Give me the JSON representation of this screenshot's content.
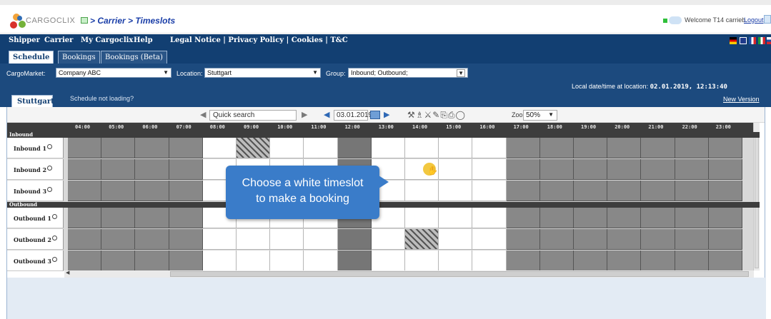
{
  "app": {
    "brand": "CARGOCLIX",
    "breadcrumb": "> Carrier > Timeslots",
    "welcome": "Welcome T14 carrieb.",
    "logout": "Logout"
  },
  "nav": {
    "items": [
      "Shipper",
      "Carrier",
      "My Cargoclix",
      "Help",
      "Legal Notice | Privacy Policy | Cookies | T&C"
    ]
  },
  "tabs": [
    "Schedule",
    "Bookings",
    "Bookings (Beta)"
  ],
  "filters": {
    "cargomarket_label": "CargoMarket:",
    "cargomarket_value": "Company ABC",
    "location_label": "Location:",
    "location_value": "Stuttgart",
    "group_label": "Group:",
    "group_value": "Inbound; Outbound;",
    "local_dt_label": "Local date/time at location:",
    "local_dt_value": "02.01.2019, 12:13:40",
    "new_version": "New Version"
  },
  "location_tab": "Stuttgart",
  "schedule_not_loading": "Schedule not loading?",
  "toolbar": {
    "quick_search": "Quick search",
    "date": "03.01.2019",
    "zoom_label": "Zoom:",
    "zoom_value": "50%",
    "tools": "⚒♗⚔✎⎘⎙◯"
  },
  "hours": [
    "04:00",
    "05:00",
    "06:00",
    "07:00",
    "08:00",
    "09:00",
    "10:00",
    "11:00",
    "12:00",
    "13:00",
    "14:00",
    "15:00",
    "16:00",
    "17:00",
    "18:00",
    "19:00",
    "20:00",
    "21:00",
    "22:00",
    "23:00"
  ],
  "groups": {
    "inbound": {
      "label": "Inbound",
      "rows": [
        {
          "name": "Inbound 1",
          "white": [
            4,
            5,
            6,
            7,
            9,
            10,
            11,
            12
          ],
          "hatch": [
            5
          ],
          "dark": [
            8
          ]
        },
        {
          "name": "Inbound 2",
          "white": [
            4,
            5,
            6,
            7,
            9,
            10,
            11,
            12
          ],
          "hatch": [],
          "dark": [
            8
          ]
        },
        {
          "name": "Inbound 3",
          "white": [
            4,
            5,
            6,
            7,
            9,
            10,
            11,
            12
          ],
          "hatch": [],
          "dark": [
            8
          ]
        }
      ]
    },
    "outbound": {
      "label": "Outbound",
      "rows": [
        {
          "name": "Outbound 1",
          "white": [
            4,
            5,
            6,
            7,
            9,
            10,
            11,
            12
          ],
          "hatch": [],
          "dark": [
            8
          ]
        },
        {
          "name": "Outbound 2",
          "white": [
            4,
            5,
            6,
            7,
            9,
            10,
            11,
            12
          ],
          "hatch": [
            10
          ],
          "dark": [
            8
          ]
        },
        {
          "name": "Outbound 3",
          "white": [
            4,
            5,
            6,
            7,
            9,
            10,
            11,
            12
          ],
          "hatch": [],
          "dark": [
            8
          ]
        }
      ]
    }
  },
  "callout": {
    "line1": "Choose a white timeslot",
    "line2": "to make a booking"
  }
}
